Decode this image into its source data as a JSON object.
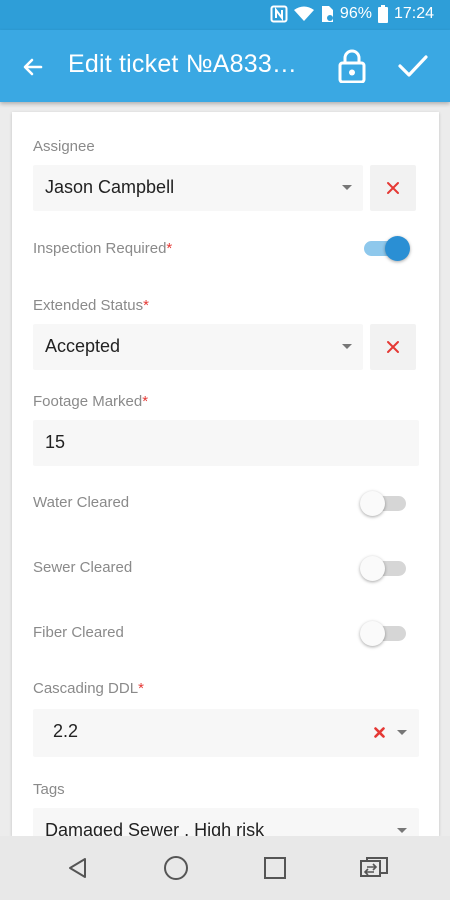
{
  "status_bar": {
    "icons": [
      "nfc-icon",
      "wifi-icon",
      "battery-saver-icon",
      "battery-icon"
    ],
    "battery": "96%",
    "time": "17:24"
  },
  "app_bar": {
    "title": "Edit ticket №A833…",
    "back_icon": "arrow-left-icon",
    "lock_icon": "lock-icon",
    "save_icon": "check-icon"
  },
  "form": {
    "assignee": {
      "label": "Assignee",
      "value": "Jason Campbell"
    },
    "inspection_required": {
      "label": "Inspection Required",
      "required_mark": "*",
      "on": true
    },
    "extended_status": {
      "label": "Extended Status",
      "required_mark": "*",
      "value": "Accepted"
    },
    "footage_marked": {
      "label": "Footage Marked",
      "required_mark": "*",
      "value": "15"
    },
    "water_cleared": {
      "label": "Water Cleared",
      "on": false
    },
    "sewer_cleared": {
      "label": "Sewer Cleared",
      "on": false
    },
    "fiber_cleared": {
      "label": "Fiber Cleared",
      "on": false
    },
    "cascading_ddl": {
      "label": "Cascading DDL",
      "required_mark": "*",
      "value": "2.2"
    },
    "tags": {
      "label": "Tags",
      "value": "Damaged Sewer , High risk"
    }
  },
  "colors": {
    "status_bar": "#2e9ed8",
    "app_bar": "#3aa8e3",
    "required": "#e53935",
    "clear_x": "#e53935",
    "toggle_on": "#2a8fd4"
  },
  "nav_bar": {
    "icons": [
      "back-triangle-icon",
      "home-circle-icon",
      "recents-square-icon",
      "switch-apps-icon"
    ]
  }
}
